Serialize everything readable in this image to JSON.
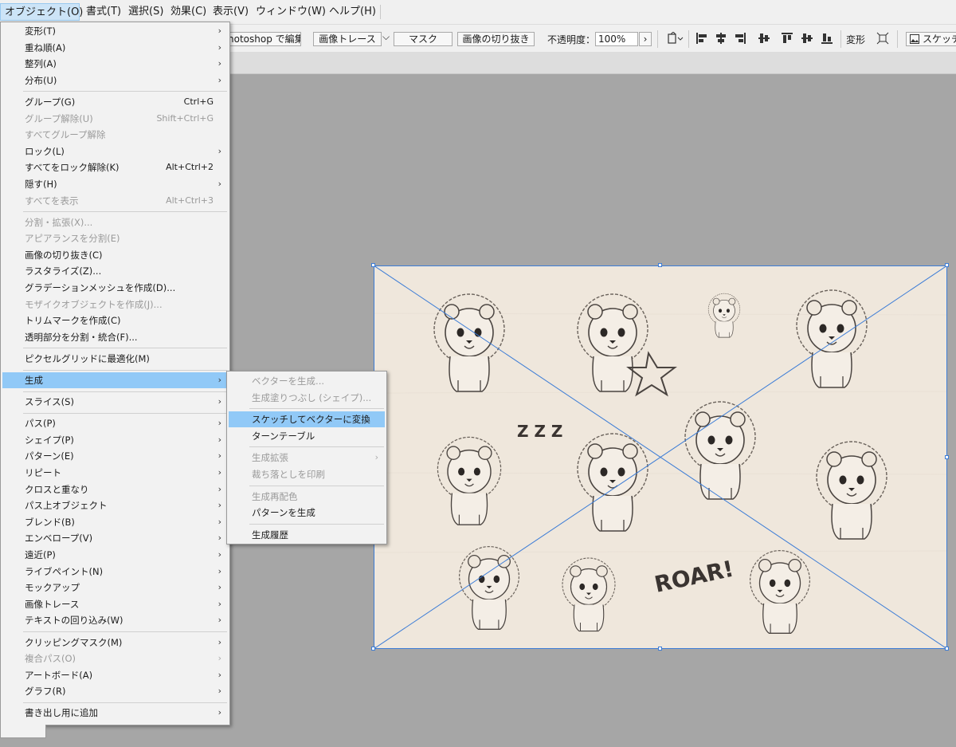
{
  "menubar": {
    "items": [
      {
        "label": "オブジェクト(O)",
        "active": true
      },
      {
        "label": "書式(T)"
      },
      {
        "label": "選択(S)"
      },
      {
        "label": "効果(C)"
      },
      {
        "label": "表示(V)"
      },
      {
        "label": "ウィンドウ(W)"
      },
      {
        "label": "ヘルプ(H)"
      }
    ]
  },
  "controlbar": {
    "photoshop_edit": "hotoshop で編集",
    "image_trace": "画像トレース",
    "image_trace_dropdown": "⌵",
    "mask": "マスク",
    "crop_image": "画像の切り抜き",
    "opacity_label": "不透明度：",
    "opacity_value": "100%",
    "opacity_arrow": "›",
    "transform_label": "変形",
    "sketch_label": "スケッチ"
  },
  "object_menu": {
    "items": [
      {
        "label": "変形(T)",
        "submenu": true
      },
      {
        "label": "重ね順(A)",
        "submenu": true
      },
      {
        "label": "整列(A)",
        "submenu": true
      },
      {
        "label": "分布(U)",
        "submenu": true
      },
      {
        "sep": true
      },
      {
        "label": "グループ(G)",
        "shortcut": "Ctrl+G"
      },
      {
        "label": "グループ解除(U)",
        "shortcut": "Shift+Ctrl+G",
        "disabled": true
      },
      {
        "label": "すべてグループ解除",
        "disabled": true
      },
      {
        "label": "ロック(L)",
        "submenu": true
      },
      {
        "label": "すべてをロック解除(K)",
        "shortcut": "Alt+Ctrl+2"
      },
      {
        "label": "隠す(H)",
        "submenu": true
      },
      {
        "label": "すべてを表示",
        "shortcut": "Alt+Ctrl+3",
        "disabled": true
      },
      {
        "sep": true
      },
      {
        "label": "分割・拡張(X)...",
        "disabled": true
      },
      {
        "label": "アピアランスを分割(E)",
        "disabled": true
      },
      {
        "label": "画像の切り抜き(C)"
      },
      {
        "label": "ラスタライズ(Z)..."
      },
      {
        "label": "グラデーションメッシュを作成(D)..."
      },
      {
        "label": "モザイクオブジェクトを作成(J)...",
        "disabled": true
      },
      {
        "label": "トリムマークを作成(C)"
      },
      {
        "label": "透明部分を分割・統合(F)..."
      },
      {
        "sep": true
      },
      {
        "label": "ピクセルグリッドに最適化(M)"
      },
      {
        "sep": true
      },
      {
        "label": "生成",
        "submenu": true,
        "highlight": true
      },
      {
        "sep": true
      },
      {
        "label": "スライス(S)",
        "submenu": true
      },
      {
        "sep": true
      },
      {
        "label": "パス(P)",
        "submenu": true
      },
      {
        "label": "シェイプ(P)",
        "submenu": true
      },
      {
        "label": "パターン(E)",
        "submenu": true
      },
      {
        "label": "リピート",
        "submenu": true
      },
      {
        "label": "クロスと重なり",
        "submenu": true
      },
      {
        "label": "パス上オブジェクト",
        "submenu": true
      },
      {
        "label": "ブレンド(B)",
        "submenu": true
      },
      {
        "label": "エンベロープ(V)",
        "submenu": true
      },
      {
        "label": "遠近(P)",
        "submenu": true
      },
      {
        "label": "ライブペイント(N)",
        "submenu": true
      },
      {
        "label": "モックアップ",
        "submenu": true
      },
      {
        "label": "画像トレース",
        "submenu": true
      },
      {
        "label": "テキストの回り込み(W)",
        "submenu": true
      },
      {
        "sep": true
      },
      {
        "label": "クリッピングマスク(M)",
        "submenu": true
      },
      {
        "label": "複合パス(O)",
        "submenu": true,
        "disabled": true
      },
      {
        "label": "アートボード(A)",
        "submenu": true
      },
      {
        "label": "グラフ(R)",
        "submenu": true
      },
      {
        "sep": true
      },
      {
        "label": "書き出し用に追加",
        "submenu": true
      }
    ]
  },
  "generate_submenu": {
    "items": [
      {
        "label": "ベクターを生成...",
        "disabled": true
      },
      {
        "label": "生成塗りつぶし (シェイプ)...",
        "disabled": true
      },
      {
        "sep": true
      },
      {
        "label": "スケッチしてベクターに変換",
        "highlight": true
      },
      {
        "label": "ターンテーブル"
      },
      {
        "sep": true
      },
      {
        "label": "生成拡張",
        "disabled": true,
        "submenu": true
      },
      {
        "label": "裁ち落としを印刷",
        "disabled": true
      },
      {
        "sep": true
      },
      {
        "label": "生成再配色",
        "disabled": true
      },
      {
        "label": "パターンを生成"
      },
      {
        "sep": true
      },
      {
        "label": "生成履歴"
      }
    ]
  },
  "artwork": {
    "text": "ROAR!",
    "zzz": "Z Z Z"
  },
  "colors": {
    "selection": "#3c7cd6",
    "highlight": "#91c9f7",
    "paper": "#efe7dc",
    "pencil": "#4a4440"
  }
}
